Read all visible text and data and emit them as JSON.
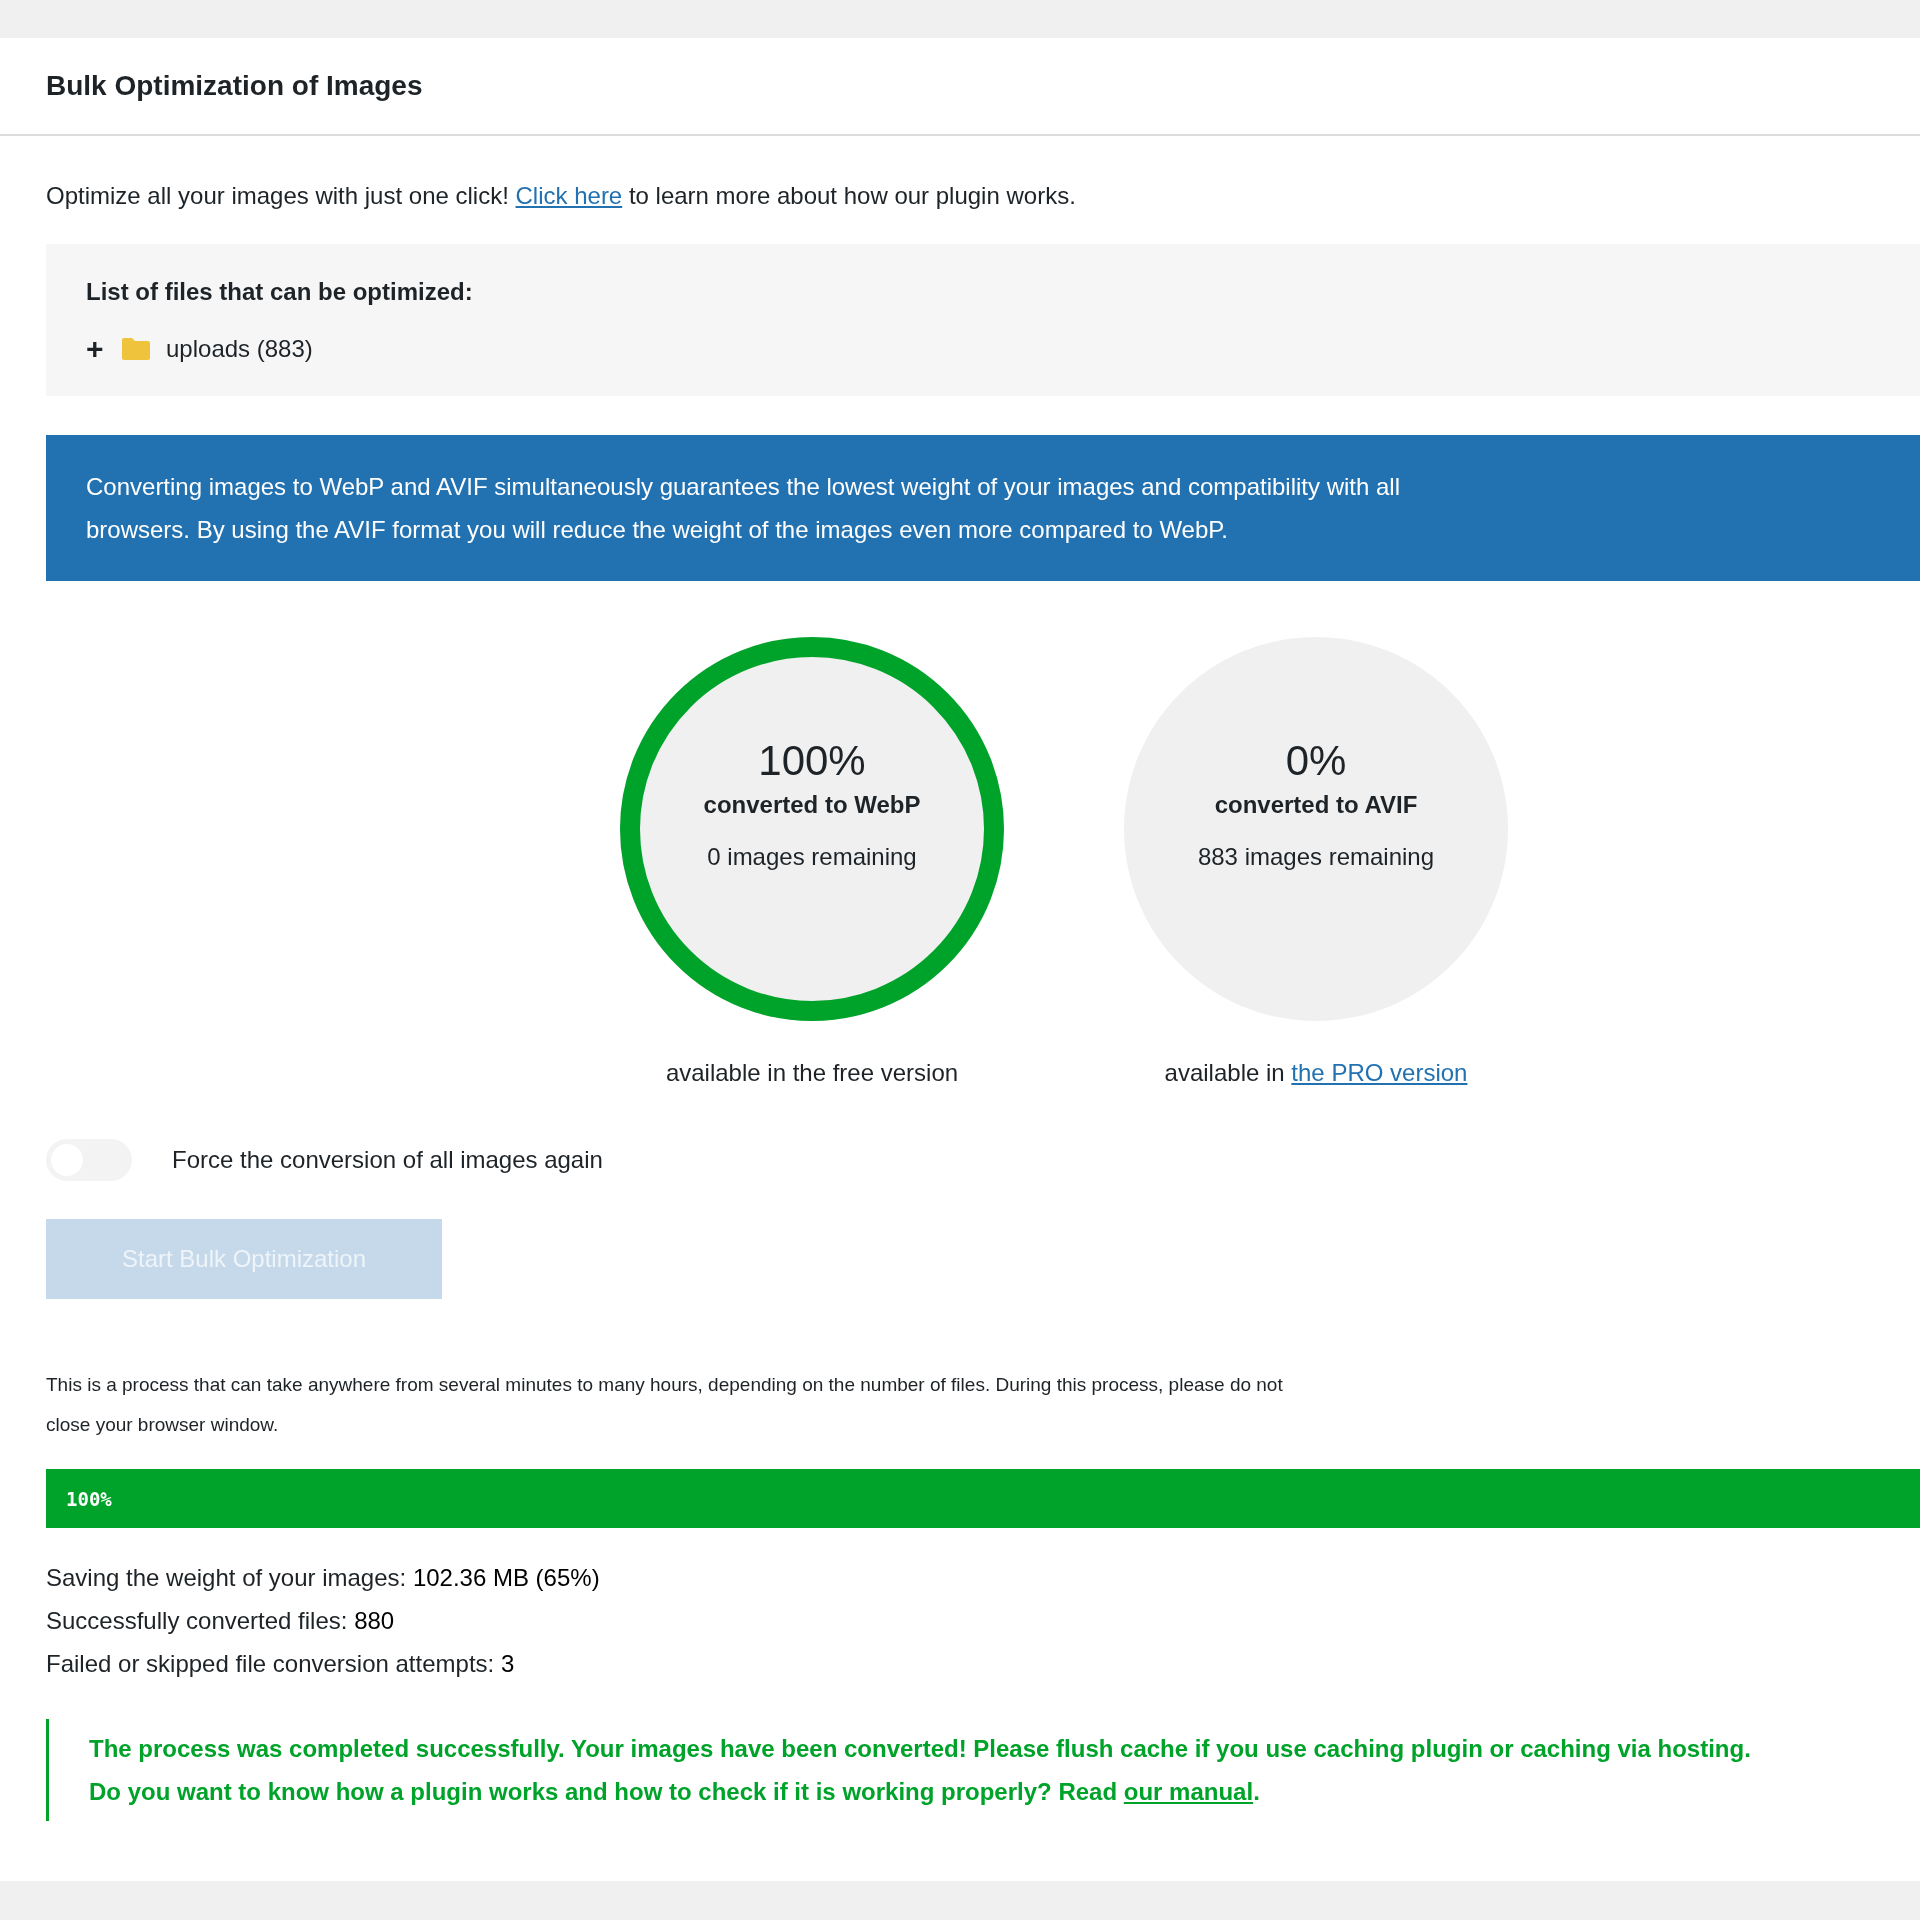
{
  "panel": {
    "title": "Bulk Optimization of Images"
  },
  "intro": {
    "before": "Optimize all your images with just one click!",
    "link": "Click here",
    "after": "to learn more about how our plugin works."
  },
  "files": {
    "heading": "List of files that can be optimized:",
    "items": [
      {
        "toggle": "+",
        "label": "uploads (883)",
        "expanded": false
      }
    ]
  },
  "notice": {
    "text": "Converting images to WebP and AVIF simultaneously guarantees the lowest weight of your images and compatibility with all browsers. By using the AVIF format you will reduce the weight of the images even more compared to WebP."
  },
  "circles": [
    {
      "percent": "100%",
      "label": "converted to WebP",
      "remaining": "0 images remaining",
      "level": 1,
      "caption": "available in the free version"
    },
    {
      "percent": "0%",
      "label": "converted to AVIF",
      "remaining": "883 images remaining",
      "caption": "available in",
      "caption_link": "the PRO version"
    }
  ],
  "force_toggle": {
    "label": "Force the conversion of all images again",
    "checked": false
  },
  "start_button": {
    "label": "Start Bulk Optimization",
    "disabled": true
  },
  "process_note": "This is a process that can take anywhere from several minutes to many hours, depending on the number of files. During this process, please do not close your browser window.",
  "progress": {
    "text": "100%",
    "level": 1
  },
  "stats": [
    {
      "label": "Saving the weight of your images:",
      "value": "102.36 MB (65%)"
    },
    {
      "label": "Successfully converted files:",
      "value": "880"
    },
    {
      "label": "Failed or skipped file conversion attempts:",
      "value": "3"
    }
  ],
  "success": {
    "text": "The process was completed successfully. Your images have been converted! Please flush cache if you use caching plugin or caching via hosting. Do you want to know how a plugin works and how to check if it is working properly? Read",
    "link": "our manual",
    "after": "."
  }
}
